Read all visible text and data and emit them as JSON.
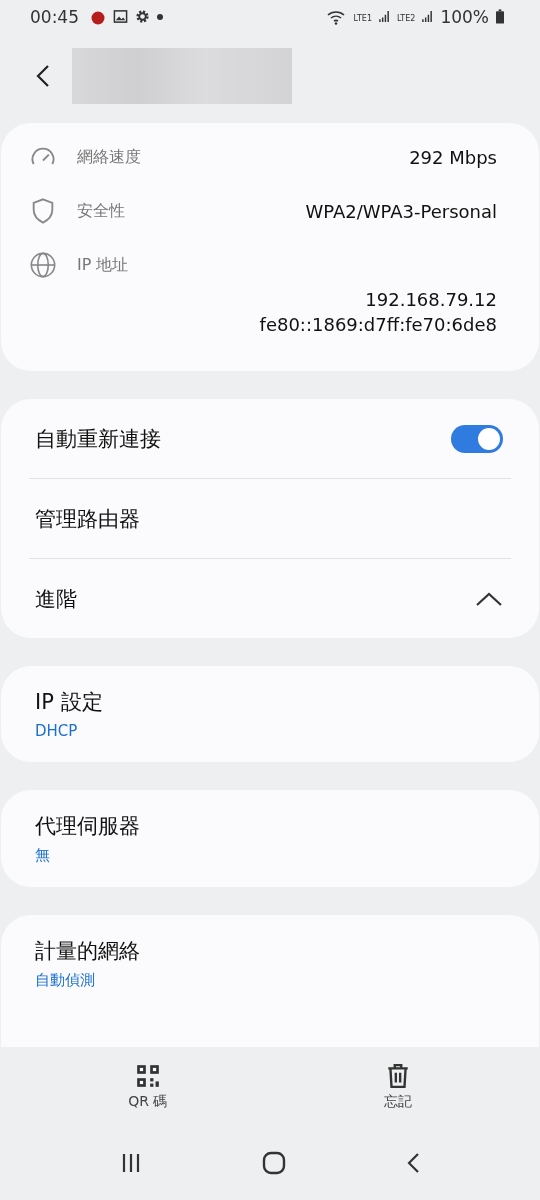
{
  "status_bar": {
    "time": "00:45",
    "sim1": "LTE1",
    "sim2": "LTE2",
    "battery": "100%"
  },
  "info": [
    {
      "kind": "speed",
      "label": "網絡速度",
      "values": [
        "292 Mbps"
      ]
    },
    {
      "kind": "security",
      "label": "安全性",
      "values": [
        "WPA2/WPA3-Personal"
      ]
    },
    {
      "kind": "ip",
      "label": "IP 地址",
      "values": [
        "192.168.79.12",
        "fe80::1869:d7ff:fe70:6de8"
      ]
    }
  ],
  "options": [
    {
      "kind": "toggle",
      "label": "自動重新連接",
      "on": true
    },
    {
      "kind": "plain",
      "label": "管理路由器"
    },
    {
      "kind": "expand",
      "label": "進階",
      "expanded": true
    }
  ],
  "settings": [
    {
      "label": "IP 設定",
      "value": "DHCP"
    },
    {
      "label": "代理伺服器",
      "value": "無"
    },
    {
      "label": "計量的網絡",
      "value": "自動偵測"
    }
  ],
  "actions": [
    {
      "kind": "qr",
      "label": "QR 碼"
    },
    {
      "kind": "delete",
      "label": "忘記"
    }
  ]
}
